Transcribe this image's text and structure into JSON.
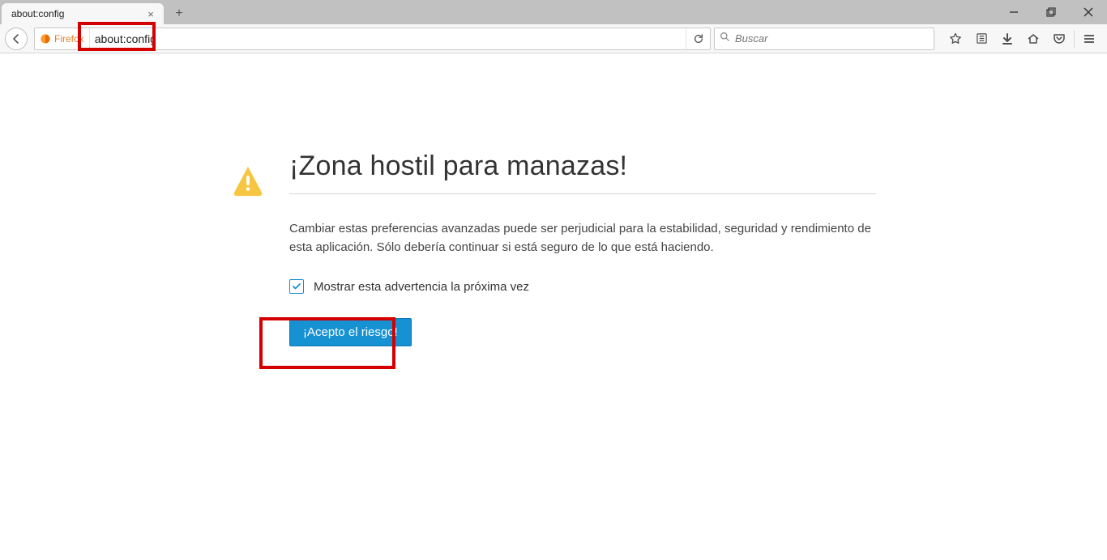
{
  "window": {
    "tab_title": "about:config"
  },
  "toolbar": {
    "identity_label": "Firefox",
    "url_value": "about:config",
    "search_placeholder": "Buscar"
  },
  "warning": {
    "title": "¡Zona hostil para manazas!",
    "body": "Cambiar estas preferencias avanzadas puede ser perjudicial para la estabilidad, seguridad y rendimiento de esta aplicación. Sólo debería continuar si está seguro de lo que está haciendo.",
    "checkbox_label": "Mostrar esta advertencia la próxima vez",
    "accept_label": "¡Acepto el riesgo!"
  }
}
